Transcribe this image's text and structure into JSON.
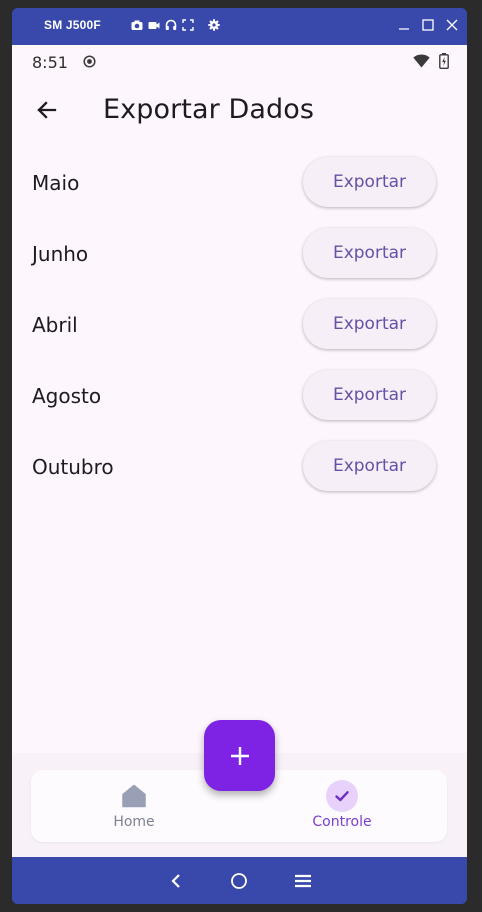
{
  "emulator": {
    "device_name": "SM J500F",
    "tools": [
      "camera-icon",
      "video-icon",
      "headphones-icon",
      "fullscreen-icon",
      "settings-icon"
    ],
    "window_controls": [
      "minimize-icon",
      "maximize-icon",
      "close-icon"
    ],
    "accent_color": "#3949ab",
    "backdrop_glyph": "II"
  },
  "status_bar": {
    "time": "8:51",
    "icons": [
      "record-icon",
      "wifi-icon",
      "battery-icon"
    ]
  },
  "app_bar": {
    "title": "Exportar Dados",
    "back_icon": "arrow-left-icon"
  },
  "months": [
    {
      "name": "Maio",
      "action": "Exportar"
    },
    {
      "name": "Junho",
      "action": "Exportar"
    },
    {
      "name": "Abril",
      "action": "Exportar"
    },
    {
      "name": "Agosto",
      "action": "Exportar"
    },
    {
      "name": "Outubro",
      "action": "Exportar"
    }
  ],
  "fab": {
    "icon": "plus-icon",
    "color": "#7e22e4"
  },
  "bottom_nav": {
    "items": [
      {
        "label": "Home",
        "icon": "home-icon",
        "selected": false
      },
      {
        "label": "Controle",
        "icon": "check-icon",
        "selected": true
      }
    ],
    "selected_color": "#7a3fd0"
  },
  "system_nav": [
    "back-icon",
    "home-circle-icon",
    "menu-icon"
  ]
}
